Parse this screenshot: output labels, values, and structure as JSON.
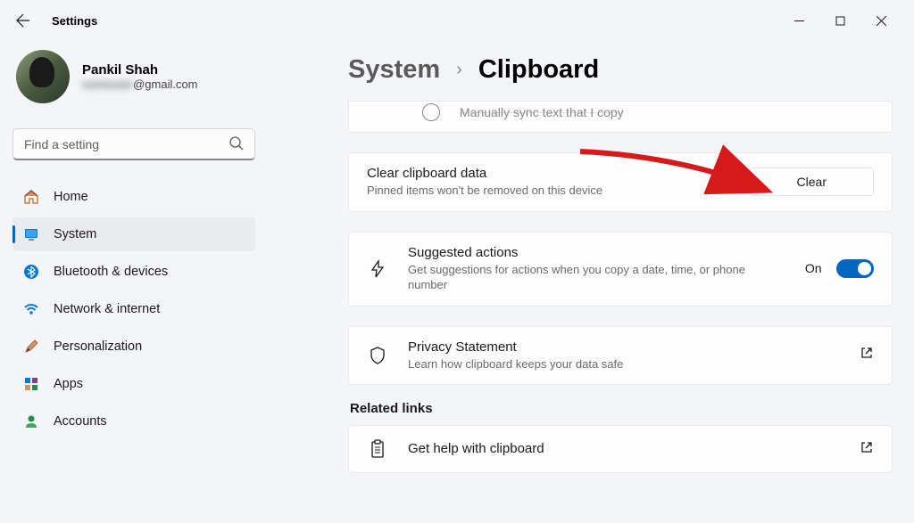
{
  "window": {
    "title": "Settings"
  },
  "profile": {
    "name": "Pankil Shah",
    "email_hidden": "someuser",
    "email_domain": "@gmail.com"
  },
  "search": {
    "placeholder": "Find a setting"
  },
  "nav": {
    "items": [
      {
        "label": "Home",
        "icon": "home"
      },
      {
        "label": "System",
        "icon": "system",
        "active": true
      },
      {
        "label": "Bluetooth & devices",
        "icon": "bluetooth"
      },
      {
        "label": "Network & internet",
        "icon": "wifi"
      },
      {
        "label": "Personalization",
        "icon": "brush"
      },
      {
        "label": "Apps",
        "icon": "apps"
      },
      {
        "label": "Accounts",
        "icon": "accounts"
      }
    ]
  },
  "breadcrumb": {
    "parent": "System",
    "current": "Clipboard"
  },
  "cards": {
    "truncated": {
      "radio_label": "Manually sync text that I copy"
    },
    "clear": {
      "title": "Clear clipboard data",
      "desc": "Pinned items won't be removed on this device",
      "button": "Clear"
    },
    "suggested": {
      "title": "Suggested actions",
      "desc": "Get suggestions for actions when you copy a date, time, or phone number",
      "state_label": "On"
    },
    "privacy": {
      "title": "Privacy Statement",
      "desc": "Learn how clipboard keeps your data safe"
    }
  },
  "related": {
    "heading": "Related links",
    "help": {
      "title": "Get help with clipboard"
    }
  }
}
